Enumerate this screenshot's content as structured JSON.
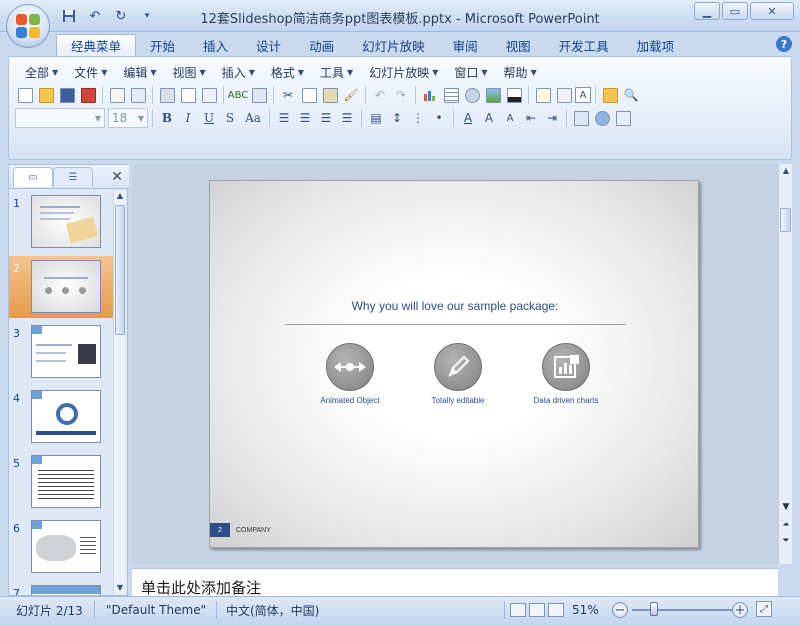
{
  "window": {
    "title": "12套Slideshop简洁商务ppt图表模板.pptx - Microsoft PowerPoint"
  },
  "tabs": [
    {
      "label": "经典菜单",
      "active": true
    },
    {
      "label": "开始"
    },
    {
      "label": "插入"
    },
    {
      "label": "设计"
    },
    {
      "label": "动画"
    },
    {
      "label": "幻灯片放映"
    },
    {
      "label": "审阅"
    },
    {
      "label": "视图"
    },
    {
      "label": "开发工具"
    },
    {
      "label": "加载项"
    }
  ],
  "menu": [
    "全部",
    "文件",
    "编辑",
    "视图",
    "插入",
    "格式",
    "工具",
    "幻灯片放映",
    "窗口",
    "帮助"
  ],
  "format_bar": {
    "font_name": "",
    "font_size": "18"
  },
  "thumbnails": [
    {
      "num": "1"
    },
    {
      "num": "2",
      "selected": true
    },
    {
      "num": "3"
    },
    {
      "num": "4"
    },
    {
      "num": "5"
    },
    {
      "num": "6"
    },
    {
      "num": "7"
    }
  ],
  "slide": {
    "title": "Why you will love our sample package:",
    "features": [
      {
        "label": "Animated Object",
        "icon": "double-arrow-icon"
      },
      {
        "label": "Totally editable",
        "icon": "pencil-icon"
      },
      {
        "label": "Data driven  charts",
        "icon": "chart-icon"
      }
    ],
    "page_number": "2",
    "company": "COMPANY"
  },
  "notes": {
    "placeholder": "单击此处添加备注"
  },
  "status": {
    "slide_info": "幻灯片 2/13",
    "theme": "\"Default Theme\"",
    "language": "中文(简体，中国)",
    "zoom": "51%"
  },
  "colors": {
    "accent": "#2b4f86",
    "selection": "#e69a4c"
  }
}
